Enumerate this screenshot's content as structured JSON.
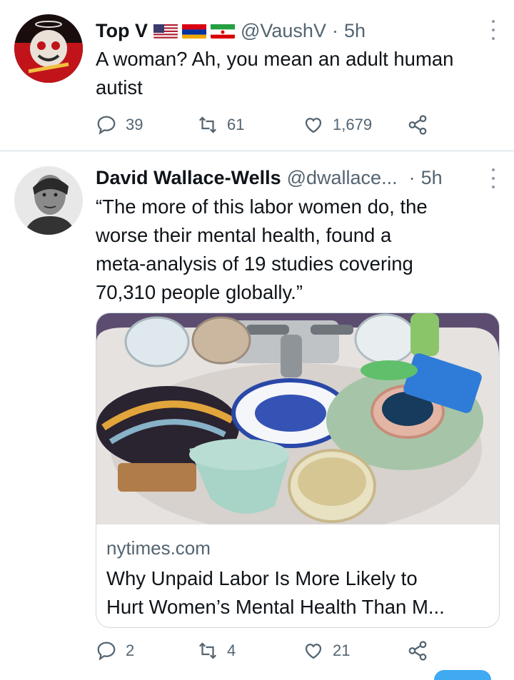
{
  "tweets": [
    {
      "display_name": "Top V",
      "handle": "@VaushV",
      "separator": "·",
      "time": "5h",
      "text_lines": [
        "A woman? Ah, you mean an adult human",
        "autist"
      ],
      "flags": [
        "us-flag-icon",
        "armenia-flag-icon",
        "iran-flag-icon"
      ],
      "replies": "39",
      "retweets": "61",
      "likes": "1,679"
    },
    {
      "display_name": "David Wallace-Wells",
      "handle": "@dwallace...",
      "separator": "·",
      "time": "5h",
      "text_lines": [
        "“The more of this labor women do, the",
        "worse their mental health, found a",
        "meta-analysis of 19 studies covering",
        "70,310 people globally.”"
      ],
      "card": {
        "domain": "nytimes.com",
        "title_lines": [
          "Why Unpaid Labor Is More Likely to",
          "Hurt Women’s Mental Health Than M..."
        ]
      },
      "replies": "2",
      "retweets": "4",
      "likes": "21"
    }
  ],
  "colors": {
    "text": "#0f1419",
    "secondary": "#536471",
    "border": "#cfd9de",
    "accent": "#1d9bf0"
  },
  "icons": [
    "reply-icon",
    "retweet-icon",
    "like-icon",
    "share-icon",
    "more-icon"
  ]
}
